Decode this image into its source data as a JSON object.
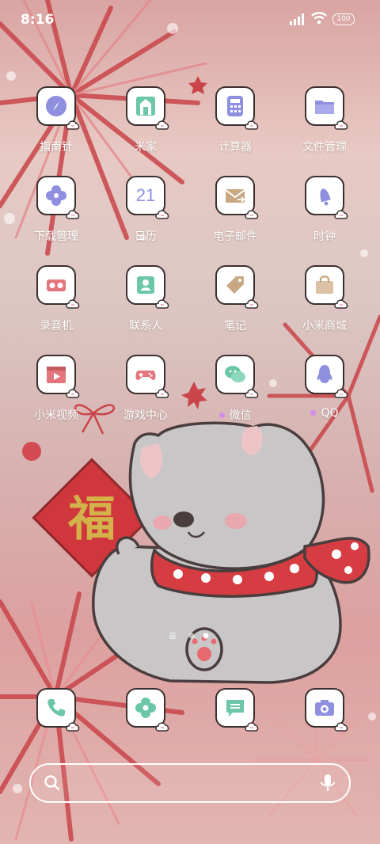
{
  "status": {
    "time": "8:16",
    "battery": "100"
  },
  "apps": [
    {
      "name": "指南针"
    },
    {
      "name": "米家"
    },
    {
      "name": "计算器"
    },
    {
      "name": "文件管理"
    },
    {
      "name": "下载管理"
    },
    {
      "name": "日历",
      "icon_text": "21"
    },
    {
      "name": "电子邮件"
    },
    {
      "name": "时钟"
    },
    {
      "name": "录音机"
    },
    {
      "name": "联系人"
    },
    {
      "name": "笔记"
    },
    {
      "name": "小米商城"
    },
    {
      "name": "小米视频"
    },
    {
      "name": "游戏中心"
    },
    {
      "name": "微信"
    },
    {
      "name": "QQ"
    }
  ],
  "wallpaper": {
    "banner_char": "福"
  },
  "colors": {
    "icon_purple": "#8f8fe0",
    "icon_green": "#6bc7a6",
    "icon_tan": "#c9a983",
    "new_dot": "#d18ce8",
    "icon_border": "#3b3030"
  }
}
